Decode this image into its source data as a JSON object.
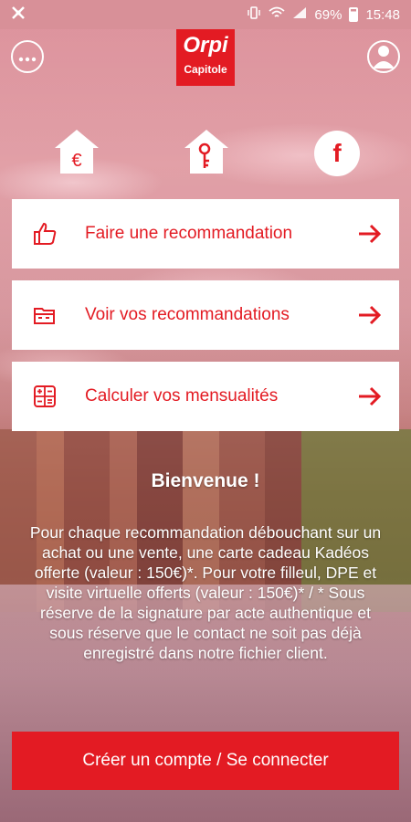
{
  "status_bar": {
    "battery": "69%",
    "time": "15:48"
  },
  "header": {
    "logo_brand": "Orpi",
    "logo_sub": "Capitole",
    "menu_icon": "more-dots-icon",
    "profile_icon": "user-profile-icon"
  },
  "quick_actions": {
    "euro_icon": "house-euro-icon",
    "key_icon": "house-key-icon",
    "facebook_label": "f"
  },
  "actions": [
    {
      "label": "Faire une recommandation",
      "icon": "thumbs-up-icon"
    },
    {
      "label": "Voir vos recommandations",
      "icon": "folder-open-icon"
    },
    {
      "label": "Calculer vos mensualités",
      "icon": "calculator-icon"
    }
  ],
  "welcome": {
    "title": "Bienvenue !",
    "text": "Pour chaque recommandation débouchant sur un achat ou une vente, une carte cadeau Kadéos offerte (valeur : 150€)*. Pour votre filleul, DPE et visite virtuelle offerts (valeur : 150€)* / * Sous réserve de la signature par acte authentique et sous réserve que le contact ne soit pas déjà enregistré dans notre fichier client."
  },
  "cta": {
    "label": "Créer un compte / Se connecter"
  },
  "colors": {
    "brand_red": "#e31b23",
    "card_bg": "#ffffff"
  }
}
